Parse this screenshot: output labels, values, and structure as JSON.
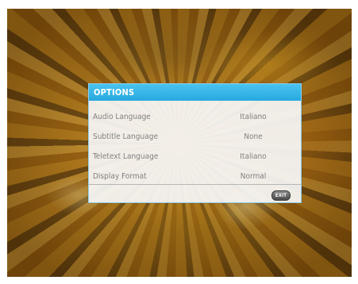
{
  "dialog": {
    "title": "OPTIONS",
    "options": [
      {
        "label": "Audio Language",
        "value": "Italiano"
      },
      {
        "label": "Subtitle Language",
        "value": "None"
      },
      {
        "label": "Teletext Language",
        "value": "Italiano"
      },
      {
        "label": "Display Format",
        "value": "Normal"
      }
    ],
    "exit_label": "EXIT"
  },
  "colors": {
    "title_bar": "#27a9df",
    "panel_bg": "#f6f6f6",
    "text": "#7f7f7f"
  }
}
